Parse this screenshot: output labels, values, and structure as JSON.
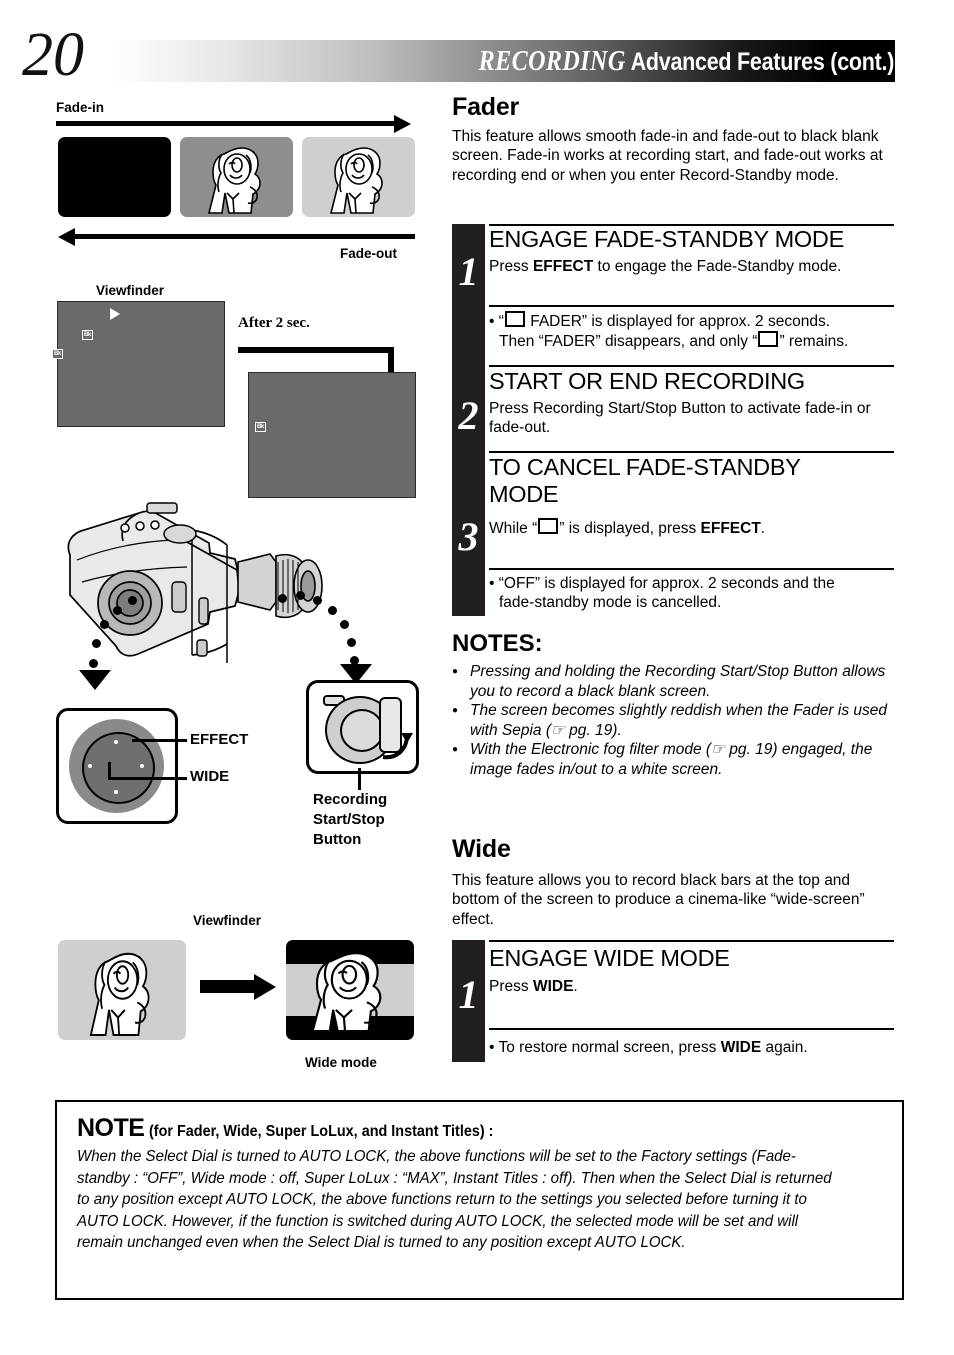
{
  "header": {
    "page_number": "20",
    "title_italic": "RECORDING",
    "title_bold": "Advanced Features (cont.)"
  },
  "left_column": {
    "fade_diagram": {
      "fade_in_label": "Fade-in",
      "fade_out_label": "Fade-out",
      "panels": [
        {
          "name": "black-blank-frame",
          "shade": "#000000"
        },
        {
          "name": "mid-fade-frame",
          "shade": "#8e8e8e"
        },
        {
          "name": "full-image-frame",
          "shade": "#cfcfcf"
        }
      ]
    },
    "viewfinder_fader": {
      "label": "Viewfinder",
      "after_label": "After 2 sec.",
      "osd_before": [
        "▶",
        "Bk",
        "Bk"
      ],
      "osd_after": [
        "Bk"
      ]
    },
    "camcorder_callouts": {
      "effect_label": "EFFECT",
      "wide_label": "WIDE",
      "recording_button_label": "Recording\nStart/Stop\nButton",
      "recording_button_lines": [
        "Recording",
        "Start/Stop",
        "Button"
      ]
    },
    "wide_diagram": {
      "label": "Viewfinder",
      "result_label": "Wide mode"
    }
  },
  "fader": {
    "title": "Fader",
    "intro": "This feature allows smooth fade-in and fade-out to black blank screen. Fade-in works at recording start, and fade-out works at recording end or when you enter Record-Standby mode.",
    "steps": [
      {
        "number": "1",
        "heading": "ENGAGE FADE-STANDBY MODE",
        "body_pre": "Press ",
        "body_bold": "EFFECT",
        "body_post": " to engage the Fade-Standby mode.",
        "note_1a": "• “",
        "note_1b": " FADER” is displayed for approx. 2 seconds.",
        "note_1c": "Then “FADER” disappears, and only “",
        "note_1d": "” remains."
      },
      {
        "number": "2",
        "heading": "START OR END RECORDING",
        "body": "Press Recording Start/Stop Button to activate fade-in or fade-out."
      },
      {
        "number": "3",
        "heading_line1": "TO CANCEL FADE-STANDBY",
        "heading_line2": "MODE",
        "body_pre": "While “",
        "body_post": "” is displayed, press ",
        "body_bold": "EFFECT",
        "body_end": ".",
        "note_line1": "• “OFF” is displayed for approx. 2 seconds and the",
        "note_line2": "fade-standby mode is cancelled."
      }
    ]
  },
  "notes": {
    "heading": "NOTES:",
    "items": [
      "Pressing and holding the Recording Start/Stop Button allows you to record a black blank screen.",
      "The screen becomes slightly reddish when the Fader is used with Sepia (☞ pg. 19).",
      "With the Electronic fog filter mode (☞ pg. 19) engaged, the image fades in/out to a white screen."
    ]
  },
  "wide": {
    "title": "Wide",
    "intro": "This feature allows you to record black bars at the top and bottom of the screen to produce a cinema-like “wide-screen” effect.",
    "step": {
      "number": "1",
      "heading": "ENGAGE WIDE MODE",
      "body_pre": "Press ",
      "body_bold": "WIDE",
      "body_post": ".",
      "note_pre": "• To restore normal screen, press ",
      "note_bold": "WIDE",
      "note_post": " again."
    }
  },
  "bottom_note": {
    "title": "NOTE",
    "subtitle": "(for Fader, Wide, Super LoLux, and Instant Titles) :",
    "body": "When the Select Dial is turned to AUTO LOCK, the above functions will be set to the Factory settings (Fade-standby : “OFF”, Wide mode : off, Super LoLux : “MAX”, Instant Titles : off). Then when the Select Dial is returned to any position except AUTO LOCK, the above functions return to the settings you selected before turning it to AUTO LOCK. However, if the function is switched during AUTO LOCK, the selected mode will be set and will remain unchanged even when the Select Dial is turned to any position except AUTO LOCK."
  }
}
